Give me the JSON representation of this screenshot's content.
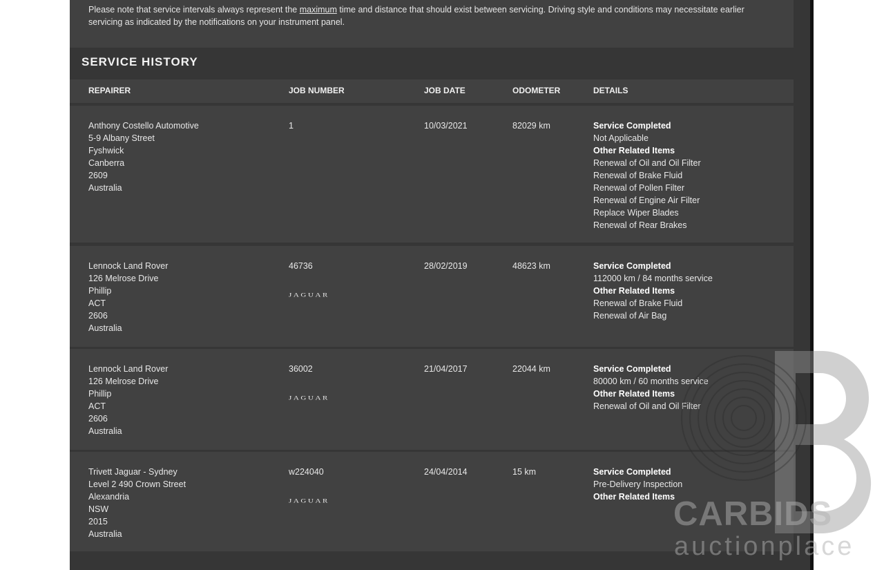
{
  "note": {
    "before": "Please note that service intervals always represent the ",
    "link": "maximum",
    "after": " time and distance that should exist between servicing. Driving style and conditions may necessitate earlier servicing as indicated by the notifications on your instrument panel."
  },
  "section_title": "SERVICE HISTORY",
  "columns": {
    "repairer": "REPAIRER",
    "job_number": "JOB NUMBER",
    "job_date": "JOB DATE",
    "odometer": "ODOMETER",
    "details": "DETAILS"
  },
  "rows": [
    {
      "repairer": [
        "Anthony Costello Automotive",
        "5-9 Albany Street",
        "Fyshwick",
        "Canberra",
        "2609",
        "Australia"
      ],
      "job_number": "1",
      "brand": "",
      "job_date": "10/03/2021",
      "odometer": "82029 km",
      "service_heading": "Service Completed",
      "service": "Not Applicable",
      "other_heading": "Other Related Items",
      "other_items": [
        "Renewal of Oil and Oil Filter",
        "Renewal of Brake Fluid",
        "Renewal of Pollen Filter",
        "Renewal of Engine Air Filter",
        "Replace Wiper Blades",
        "Renewal of Rear Brakes"
      ]
    },
    {
      "repairer": [
        "Lennock Land Rover",
        "126 Melrose Drive",
        "Phillip",
        "ACT",
        "2606",
        "Australia"
      ],
      "job_number": "46736",
      "brand": "JAGUAR",
      "job_date": "28/02/2019",
      "odometer": "48623 km",
      "service_heading": "Service Completed",
      "service": "112000 km / 84 months service",
      "other_heading": "Other Related Items",
      "other_items": [
        "Renewal of Brake Fluid",
        "Renewal of Air Bag"
      ]
    },
    {
      "repairer": [
        "Lennock Land Rover",
        "126 Melrose Drive",
        "Phillip",
        "ACT",
        "2606",
        "Australia"
      ],
      "job_number": "36002",
      "brand": "JAGUAR",
      "job_date": "21/04/2017",
      "odometer": "22044 km",
      "service_heading": "Service Completed",
      "service": "80000 km / 60 months service",
      "other_heading": "Other Related Items",
      "other_items": [
        "Renewal of Oil and Oil Filter"
      ]
    },
    {
      "repairer": [
        "Trivett Jaguar - Sydney",
        "Level 2 490 Crown Street",
        "Alexandria",
        "NSW",
        "2015",
        "Australia"
      ],
      "job_number": "w224040",
      "brand": "JAGUAR",
      "job_date": "24/04/2014",
      "odometer": "15 km",
      "service_heading": "Service Completed",
      "service": "Pre-Delivery Inspection",
      "other_heading": "Other Related Items",
      "other_items": []
    }
  ],
  "watermark": {
    "logo_text": "CARBIDS",
    "sub_text": "auctionplace"
  },
  "colors": {
    "panel_bg": "#363636",
    "row_bg": "#414141",
    "text": "#e8e8e8"
  }
}
